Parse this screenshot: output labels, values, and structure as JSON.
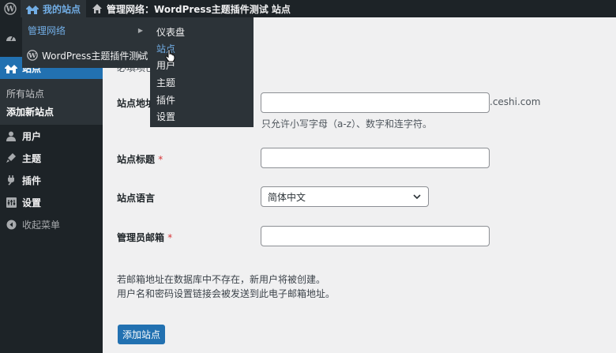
{
  "admin_bar": {
    "wp_logo_icon": "wordpress-logo-icon",
    "my_sites": {
      "icon": "my-sites-icon",
      "label": "我的站点"
    },
    "network": {
      "icon": "home-icon",
      "label": "管理网络：WordPress主题插件测试 站点"
    }
  },
  "flyout_sites": {
    "items": [
      {
        "label": "管理网络",
        "state": "open"
      },
      {
        "label": "WordPress主题插件测试",
        "icon": "wordpress-logo-icon"
      }
    ]
  },
  "flyout_network": {
    "items": [
      "仪表盘",
      "站点",
      "用户",
      "主题",
      "插件",
      "设置"
    ],
    "hovered": "站点"
  },
  "sidebar": {
    "current": {
      "label": "站点",
      "icon": "sites-icon"
    },
    "submenu": [
      {
        "label": "所有站点"
      },
      {
        "label": "添加新站点",
        "current": true
      }
    ],
    "items": [
      {
        "label": "用户",
        "icon": "users-icon"
      },
      {
        "label": "主题",
        "icon": "themes-icon"
      },
      {
        "label": "插件",
        "icon": "plugins-icon"
      },
      {
        "label": "设置",
        "icon": "settings-icon"
      },
      {
        "label": "收起菜单",
        "icon": "collapse-icon"
      }
    ]
  },
  "form": {
    "required_note_fragment": "必填项已",
    "site_address": {
      "label": "站点地址",
      "value": "",
      "suffix": ".ceshi.com",
      "help": "只允许小写字母（a-z）、数字和连字符。"
    },
    "site_title": {
      "label": "站点标题",
      "required_mark": "*",
      "value": ""
    },
    "site_language": {
      "label": "站点语言",
      "selected": "简体中文"
    },
    "admin_email": {
      "label": "管理员邮箱",
      "required_mark": "*",
      "value": ""
    },
    "note_line1": "若邮箱地址在数据库中不存在，新用户将被创建。",
    "note_line2": "用户名和密码设置链接会被发送到此电子邮箱地址。",
    "submit_label": "添加站点"
  },
  "colors": {
    "admin_bar_bg": "#1d2327",
    "menu_bg": "#1d2327",
    "flyout_bg": "#2c3338",
    "accent": "#2271b1",
    "highlight_text": "#72aee6",
    "required": "#d63638",
    "page_bg": "#f0f0f1"
  }
}
